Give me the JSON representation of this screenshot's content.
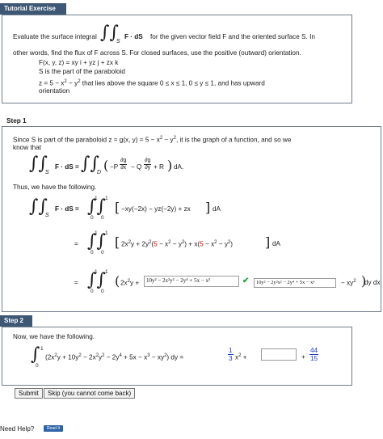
{
  "tutorial": {
    "title": "Tutorial Exercise",
    "problem_intro": "Evaluate the surface integral",
    "problem_tail": "for the given vector field F and the oriented surface S. In",
    "integrand": "F · dS",
    "sub_S": "S",
    "line2": "other words, find the flux of F across S. For closed surfaces, use the positive (outward) orientation.",
    "field_def": "F(x, y, z) = xy i + yz j + zx k",
    "surface_def": "S is the part of the paraboloid",
    "surface_eq_pre": "z = 5 − x",
    "surface_eq_post": " that lies above the square 0 ≤ x ≤ 1, 0 ≤ y ≤ 1, and has upward",
    "orientation": "orientation"
  },
  "step1": {
    "label": "Step 1",
    "text1": "Since S is part of the paraboloid z = g(x, y) = 5 − x",
    "text1b": ", it is the graph of a function, and so we",
    "text2": "know that",
    "formula_lhs": "F · dS =",
    "formula_rhs_a": "−P",
    "formula_rhs_b": " − Q",
    "formula_rhs_c": " + R",
    "formula_rhs_d": "dA.",
    "frac_num": "∂g",
    "frac_den_x": "∂x",
    "frac_den_y": "∂y",
    "sub_D": "D",
    "thus": "Thus, we have the following.",
    "line_a_lhs": "F · dS =",
    "line_a_rhs": "−xy(−2x) − yz(−2y) + zx",
    "line_a_da": "dA",
    "line_b_rhs_1": "2x",
    "line_b_rhs_2": "y + 2y",
    "line_b_five": "5",
    "line_b_rhs_3": " − x",
    "line_b_rhs_4": " − y",
    "line_b_rhs_5": ") + x(",
    "line_b_rhs_6": " − x",
    "line_b_rhs_7": " − y",
    "line_b_rhs_8": "dA",
    "line_c_rhs_1": "2x",
    "line_c_rhs_2": "y +",
    "line_c_answer": "10y² − 2x²y² − 2y⁴ + 5x − x³",
    "line_c_answer_right": "10y² − 2y²x² − 2y⁴ + 5x − x³",
    "line_c_tail": "− xy",
    "line_c_dy_dx": "dy dx",
    "lim_0": "0",
    "lim_1": "1"
  },
  "step2": {
    "label": "Step 2",
    "text": "Now, we have the following.",
    "integrand_1": "(2x",
    "integrand_2": "y + 10y",
    "integrand_3": " − 2x",
    "integrand_4": "y",
    "integrand_5": " − 2y",
    "integrand_6": " + 5x − x",
    "integrand_7": " − xy",
    "integrand_8": ") dy =",
    "coef_num": "1",
    "coef_den": "3",
    "x_sq": "x",
    "plus": "+",
    "answer_value": "",
    "frac2_num": "44",
    "frac2_den": "15"
  },
  "buttons": {
    "submit": "Submit",
    "skip": "Skip (you cannot come back)"
  },
  "help": {
    "label": "Need Help?",
    "read_it": "Read It"
  },
  "colors": {
    "header_bg": "#3d5775",
    "check": "#24a148",
    "highlight": "#cc0000",
    "blue_fraction": "#1d39c4"
  }
}
